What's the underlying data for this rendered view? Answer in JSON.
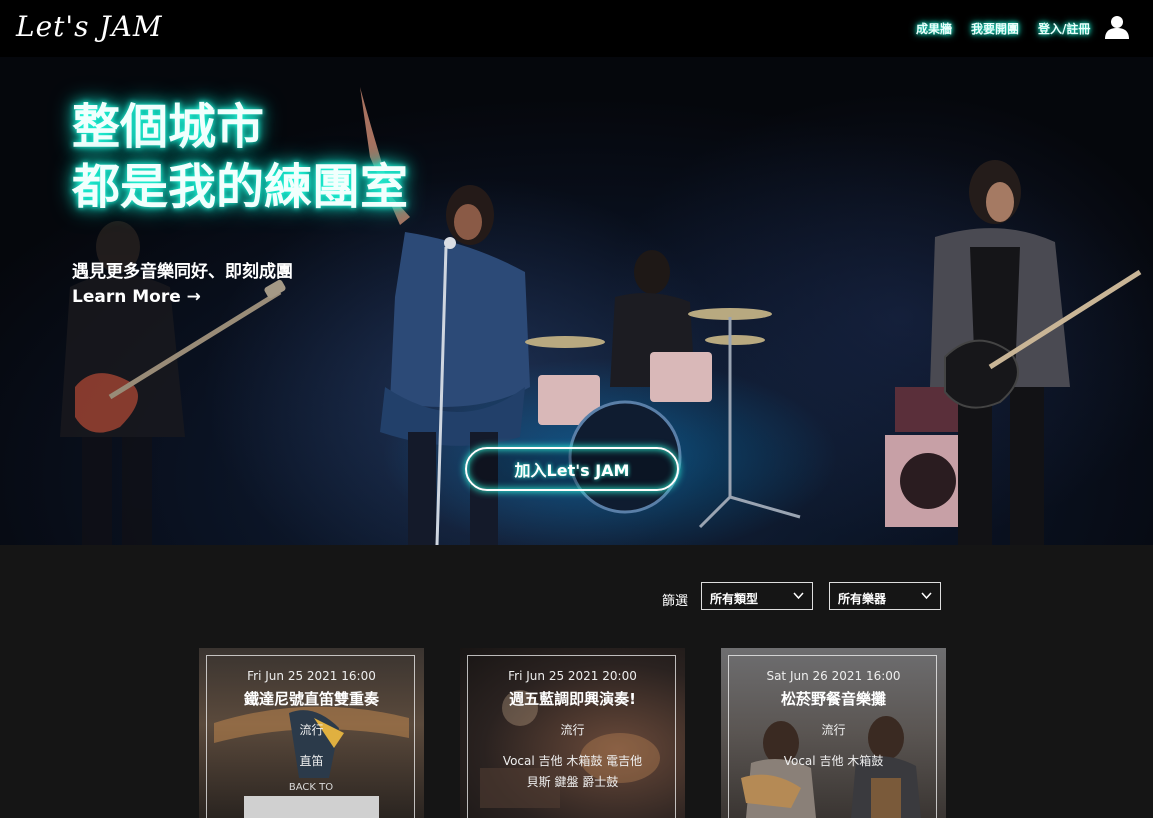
{
  "nav": {
    "logo": "Let's JAM",
    "links": [
      "成果牆",
      "我要開團",
      "登入/註冊"
    ]
  },
  "hero": {
    "title_line1": "整個城市",
    "title_line2": "都是我的練團室",
    "subtitle": "遇見更多音樂同好、即刻成團",
    "learn_more": "Learn More →",
    "join_button": "加入Let's JAM"
  },
  "filters": {
    "label": "篩選",
    "genre_selected": "所有類型",
    "instrument_selected": "所有樂器"
  },
  "cards": [
    {
      "date": "Fri Jun 25 2021 16:00",
      "title": "鐵達尼號直笛雙重奏",
      "genre": "流行",
      "instruments_line1": "直笛",
      "instruments_line2": "",
      "poster_text": "BACK TO"
    },
    {
      "date": "Fri Jun 25 2021 20:00",
      "title": "週五藍調即興演奏!",
      "genre": "流行",
      "instruments_line1": "Vocal 吉他 木箱鼓 電吉他",
      "instruments_line2": "貝斯 鍵盤 爵士鼓"
    },
    {
      "date": "Sat Jun 26 2021 16:00",
      "title": "松菸野餐音樂攤",
      "genre": "流行",
      "instruments_line1": "Vocal 吉他 木箱鼓",
      "instruments_line2": ""
    }
  ],
  "colors": {
    "neon": "#19e6c8",
    "nav_bg": "#000000",
    "page_bg": "#151515"
  },
  "icons": {
    "user": "user-icon",
    "chevron": "chevron-down-icon",
    "arrow": "arrow-right-icon"
  }
}
